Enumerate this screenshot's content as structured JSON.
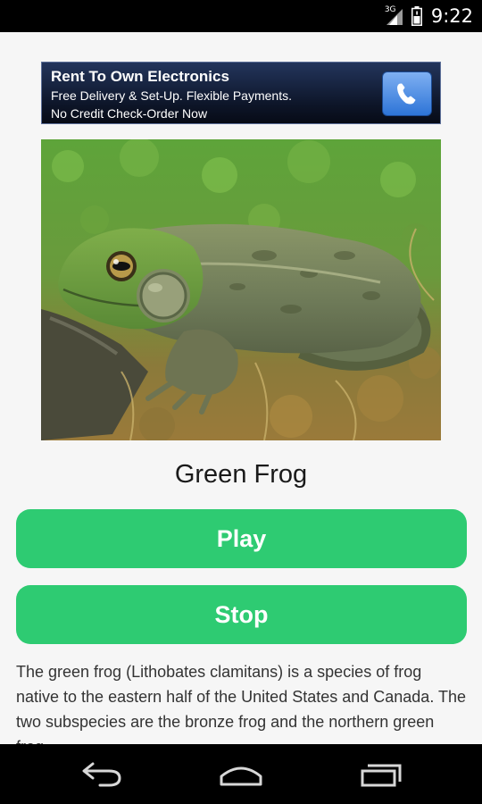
{
  "status_bar": {
    "network_type": "3G",
    "time": "9:22"
  },
  "ad": {
    "title": "Rent To Own Electronics",
    "line1": "Free Delivery & Set-Up. Flexible Payments.",
    "line2": "No Credit Check-Order Now",
    "call_icon": "phone-icon"
  },
  "animal": {
    "image": "frog-photo",
    "name": "Green Frog",
    "description": "The green frog (Lithobates clamitans) is a species of frog native to the eastern half of the United States and Canada. The two subspecies are the bronze frog and the northern green frog."
  },
  "controls": {
    "play_label": "Play",
    "stop_label": "Stop"
  },
  "nav_bar": {
    "icons": [
      "back-icon",
      "home-icon",
      "recents-icon"
    ]
  },
  "colors": {
    "button": "#2ecb72",
    "status_bar": "#000000",
    "ad_background": "#0d1528"
  }
}
